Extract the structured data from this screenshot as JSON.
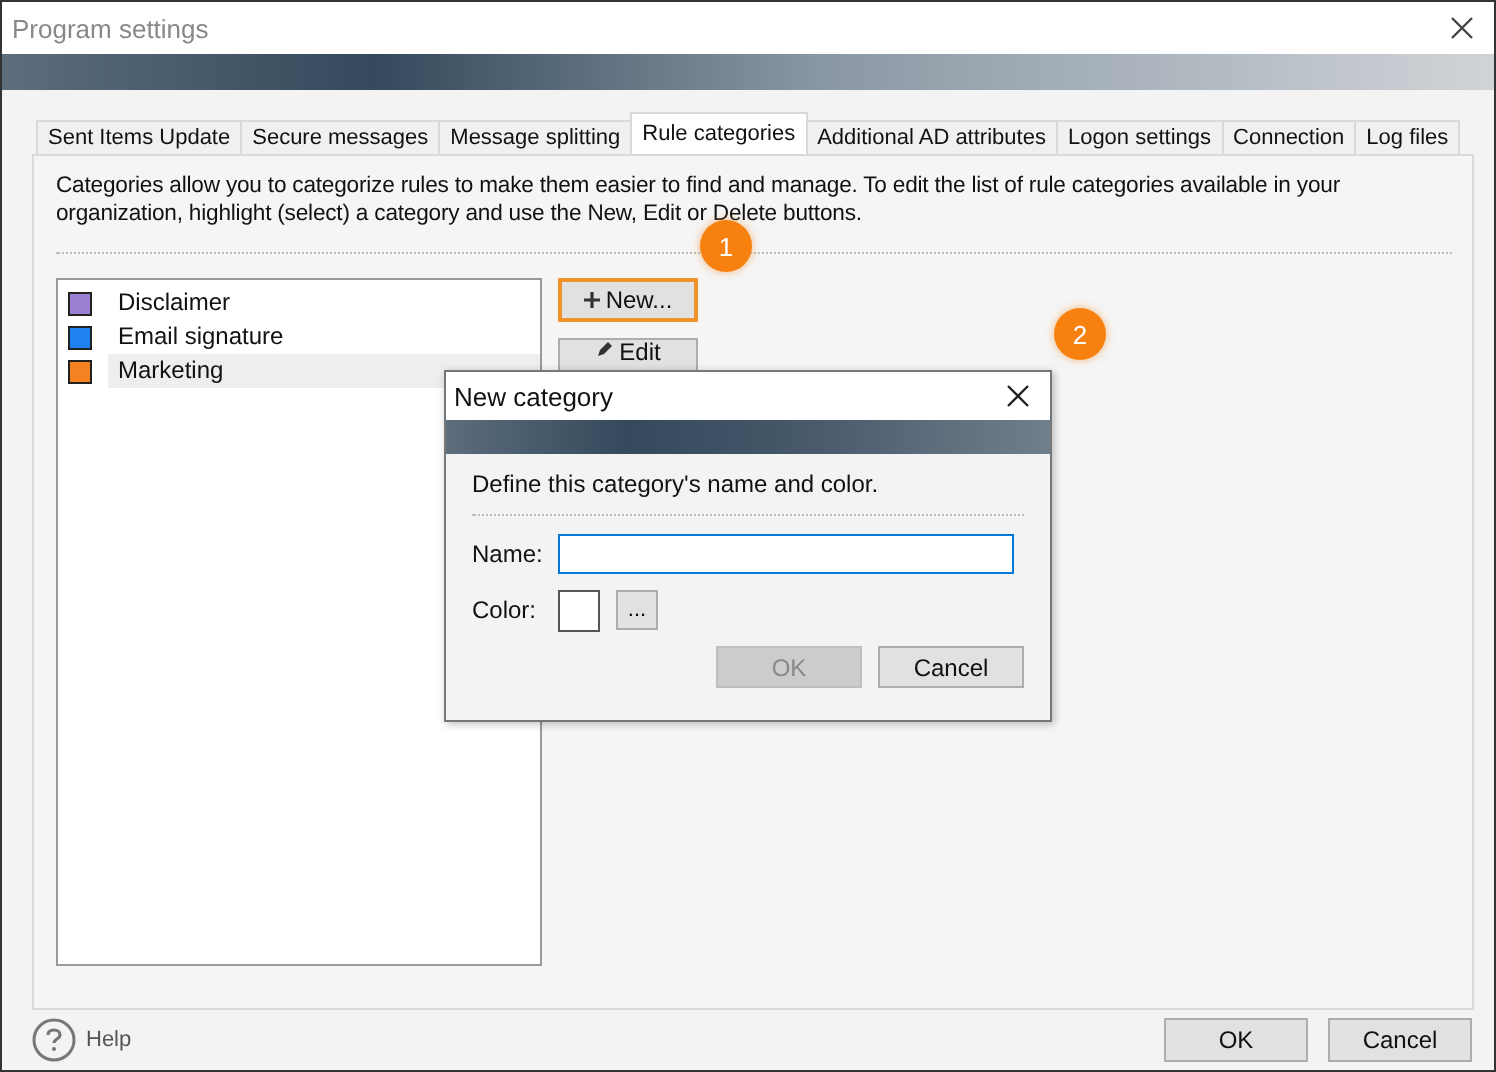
{
  "window": {
    "title": "Program settings"
  },
  "tabs": [
    {
      "label": "Sent Items Update",
      "selected": false
    },
    {
      "label": "Secure messages",
      "selected": false
    },
    {
      "label": "Message splitting",
      "selected": false
    },
    {
      "label": "Rule categories",
      "selected": true
    },
    {
      "label": "Additional AD attributes",
      "selected": false
    },
    {
      "label": "Logon settings",
      "selected": false
    },
    {
      "label": "Connection",
      "selected": false
    },
    {
      "label": "Log files",
      "selected": false
    }
  ],
  "description": "Categories allow you to categorize rules to make them easier to find and manage. To edit the list of rule categories available in your organization, highlight (select) a category and use the New, Edit or Delete buttons.",
  "categories": [
    {
      "name": "Disclaimer",
      "color": "#9b7fd0",
      "selected": false
    },
    {
      "name": "Email signature",
      "color": "#1e82f0",
      "selected": false
    },
    {
      "name": "Marketing",
      "color": "#f58220",
      "selected": true
    }
  ],
  "side_buttons": [
    {
      "label": "New...",
      "kind": "new",
      "highlighted": true
    },
    {
      "label": "Edit",
      "kind": "edit",
      "highlighted": false
    }
  ],
  "callouts": [
    "1",
    "2"
  ],
  "dialog": {
    "title": "New category",
    "instruction": "Define this category's name and color.",
    "name_label": "Name:",
    "color_label": "Color:",
    "color_button": "...",
    "buttons": [
      {
        "label": "OK",
        "disabled": true
      },
      {
        "label": "Cancel",
        "disabled": false
      }
    ]
  },
  "help": "Help",
  "footer_buttons": [
    "OK",
    "Cancel"
  ]
}
